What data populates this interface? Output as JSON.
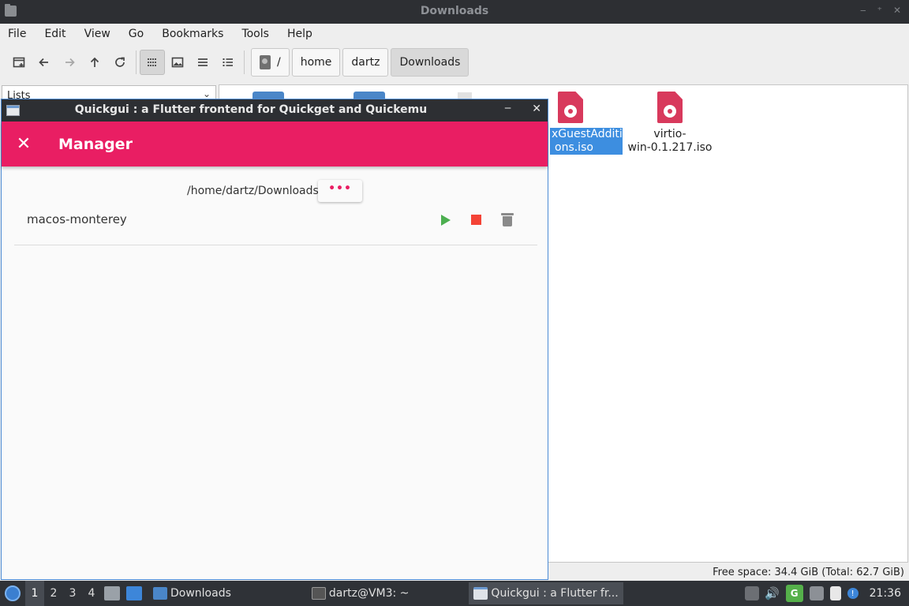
{
  "file_manager": {
    "title": "Downloads",
    "controls": {
      "minimize": "‒",
      "maximize": "⁺",
      "close": "✕"
    },
    "menu": [
      "File",
      "Edit",
      "View",
      "Go",
      "Bookmarks",
      "Tools",
      "Help"
    ],
    "breadcrumbs": [
      {
        "label": "/",
        "icon": "drive-icon"
      },
      {
        "label": "home"
      },
      {
        "label": "dartz"
      },
      {
        "label": "Downloads",
        "active": true
      }
    ],
    "side_combo": "Lists",
    "files": [
      {
        "label_line1": "xGuestAdditi",
        "label_line2": "ons.iso",
        "selected": true,
        "icon": "iso-file-icon"
      },
      {
        "label_line1": "virtio-",
        "label_line2": "win-0.1.217.iso",
        "selected": false,
        "icon": "iso-file-icon"
      }
    ],
    "status": "Free space: 34.4 GiB (Total: 62.7 GiB)"
  },
  "quickgui": {
    "title": "Quickgui : a Flutter frontend for Quickget and Quickemu",
    "min_label": "‒",
    "close_label": "✕",
    "appbar_close": "✕",
    "appbar_title": "Manager",
    "path": "/home/dartz/Downloads",
    "more_button": "•••",
    "vms": [
      {
        "name": "macos-monterey"
      }
    ],
    "accent": "#e91e63"
  },
  "taskbar": {
    "workspaces": [
      "1",
      "2",
      "3",
      "4"
    ],
    "tasks": [
      {
        "label": "Downloads",
        "icon": "folder-icon"
      },
      {
        "label": "dartz@VM3: ~",
        "icon": "terminal-icon"
      },
      {
        "label": "Quickgui : a Flutter fr...",
        "icon": "window-icon",
        "active": true
      }
    ],
    "clock": "21:36"
  }
}
